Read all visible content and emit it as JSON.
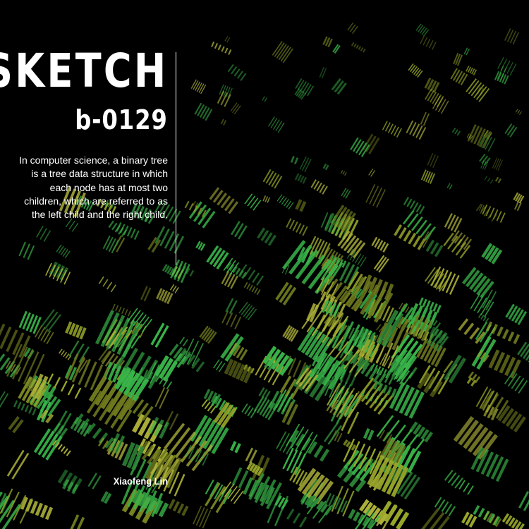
{
  "title": "SKETCH",
  "subtitle": "b-0129",
  "description": "In computer science, a binary tree is a tree data structure in which each node has at most two children, which are referred to as the left child and the right child.",
  "author": "Xiaofeng Lin",
  "colors": {
    "background": "#000000",
    "text": "#ffffff",
    "bright_green": "#39b54a",
    "yellow_green": "#9aa82a",
    "olive": "#6f7a1e"
  }
}
